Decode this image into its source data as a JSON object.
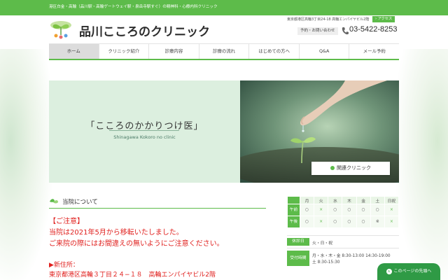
{
  "topbar": {
    "text": "港区白金・高輪（品川駅・高輪ゲートウェイ駅・泉岳寺駅すぐ）の精神科・心療内科クリニック"
  },
  "header": {
    "logo_text": "品川こころのクリニック",
    "address": "東京都港区高輪3丁目24-18 高輪エンパイヤビル2階",
    "access_label": "› アクセス",
    "contact_label": "予約・お問い合わせ",
    "phone": "03-5422-8253"
  },
  "nav": {
    "items": [
      {
        "label": "ホーム",
        "active": true
      },
      {
        "label": "クリニック紹介"
      },
      {
        "label": "診療内容"
      },
      {
        "label": "診療の流れ"
      },
      {
        "label": "はじめての方へ"
      },
      {
        "label": "Q&A"
      },
      {
        "label": "メール予約"
      }
    ]
  },
  "hero": {
    "tagline": "「こころのかかりつけ医」",
    "subtitle": "Shinagawa Kokoro no clinic",
    "related_button": "関連クリニック"
  },
  "section": {
    "title": "当院について"
  },
  "notice": {
    "lines": [
      "【ご注意】",
      "当院は2021年5月から移転いたしました。",
      "ご来院の際にはお間違えの無いようにご注意ください。"
    ],
    "new_address_label": "▶新住所：",
    "new_address": "東京都港区高輪３丁目２４−１８　高輪エンパイヤビル2階"
  },
  "schedule": {
    "days": [
      "月",
      "火",
      "水",
      "木",
      "金",
      "土",
      "日祝"
    ],
    "rows": [
      {
        "label": "午前",
        "cells": [
          "○",
          "×",
          "○",
          "○",
          "○",
          "○",
          "×"
        ]
      },
      {
        "label": "午後",
        "cells": [
          "○",
          "×",
          "○",
          "○",
          "○",
          "※",
          "×"
        ]
      }
    ],
    "closed_label": "休診日",
    "closed_value": "火・日・祝",
    "hours_label": "受付時間",
    "hours_weekday": "月・水・木・金 8:30-13:00  14:30-19:00",
    "hours_sat": "土 8:30-15:30"
  },
  "page_top": {
    "label": "このページの先頭へ",
    "arrow": "∧"
  },
  "colors": {
    "brand_green": "#5dbb4a",
    "dark_green": "#2f9a45",
    "notice_red": "#e0201e",
    "hero_bg": "#dcefdf"
  }
}
